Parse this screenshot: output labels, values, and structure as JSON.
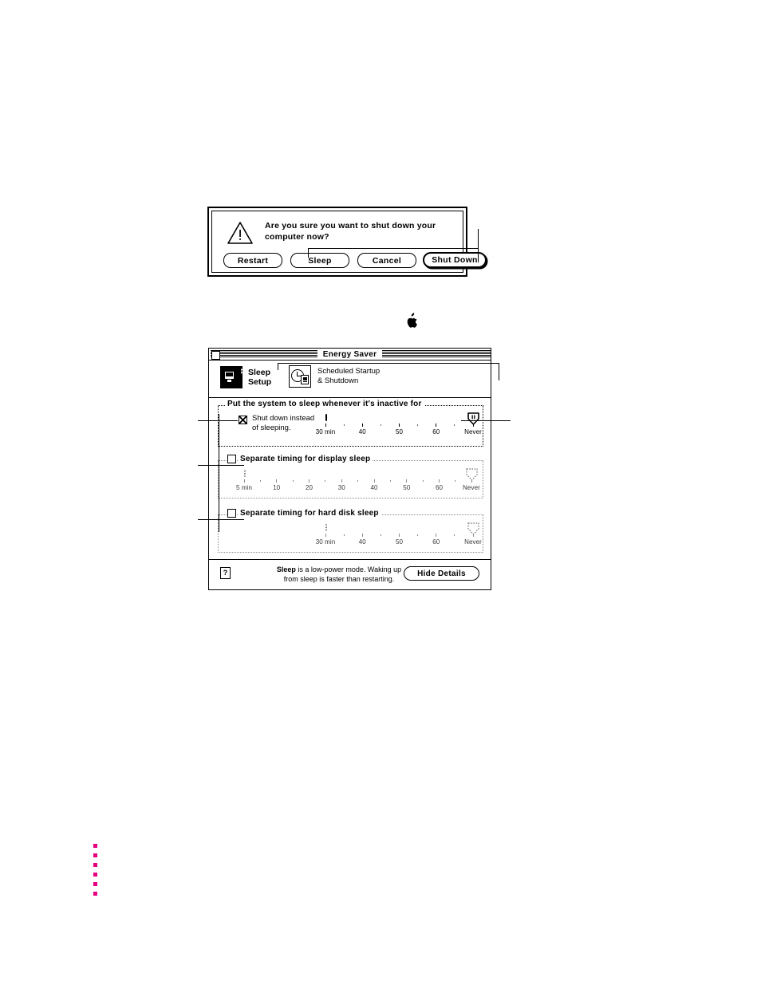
{
  "alert": {
    "icon": "warning-triangle-icon",
    "message": "Are you sure you want to shut down your computer now?",
    "buttons": [
      {
        "label": "Restart",
        "default": false
      },
      {
        "label": "Sleep",
        "default": false
      },
      {
        "label": "Cancel",
        "default": false
      },
      {
        "label": "Shut Down",
        "default": true
      }
    ]
  },
  "apple_logo": "apple-logo-icon",
  "window": {
    "title": "Energy Saver",
    "tabs": [
      {
        "label_line1": "Sleep",
        "label_line2": "Setup",
        "selected": true,
        "icon": "sleep-computer-icon",
        "zz": "zz"
      },
      {
        "label_line1": "Scheduled Startup",
        "label_line2": "& Shutdown",
        "selected": false,
        "icon": "clock-schedule-icon"
      }
    ],
    "groups": {
      "system": {
        "title": "Put the system to sleep whenever it's inactive for",
        "checkbox": {
          "label_line1": "Shut down instead",
          "label_line2": "of sleeping.",
          "checked": true
        },
        "slider": {
          "enabled": true,
          "value": "Never",
          "thumb_percent": 100,
          "labels": [
            "30 min",
            "40",
            "50",
            "60",
            "Never"
          ],
          "label_percents": [
            0,
            25,
            50,
            75,
            100
          ]
        }
      },
      "display": {
        "title": "Separate timing for display sleep",
        "checkbox": {
          "checked": false
        },
        "slider": {
          "enabled": false,
          "value": "Never",
          "thumb_percent": 100,
          "labels": [
            "5 min",
            "10",
            "20",
            "30",
            "40",
            "50",
            "60",
            "Never"
          ],
          "label_percents": [
            0,
            14.3,
            28.6,
            42.9,
            57.2,
            71.5,
            85.8,
            100
          ]
        }
      },
      "hard_disk": {
        "title": "Separate timing for hard disk sleep",
        "checkbox": {
          "checked": false
        },
        "slider": {
          "enabled": false,
          "value": "Never",
          "thumb_percent": 100,
          "labels": [
            "30 min",
            "40",
            "50",
            "60",
            "Never"
          ],
          "label_percents": [
            0,
            25,
            50,
            75,
            100
          ]
        }
      }
    },
    "help": {
      "icon": "question-mark-icon",
      "bold_word": "Sleep",
      "text_rest": " is a low-power mode. Waking up",
      "text_line2": "from sleep is faster than restarting.",
      "button_label": "Hide Details"
    }
  },
  "decorations": {
    "dot_color": "#e5007e",
    "dot_count": 6
  }
}
